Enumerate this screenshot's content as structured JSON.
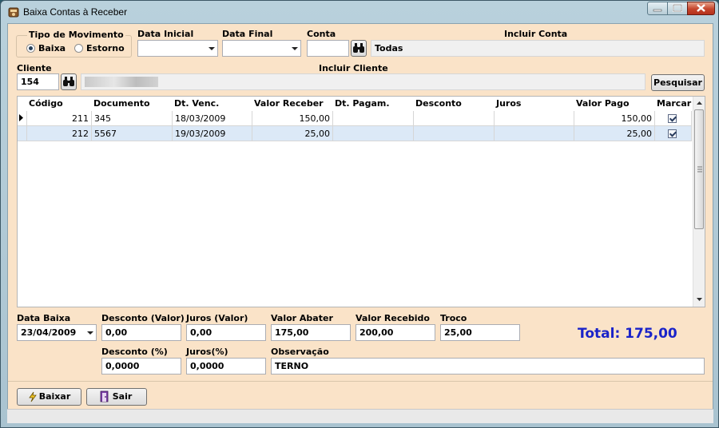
{
  "window": {
    "title": "Baixa Contas à Receber"
  },
  "filters": {
    "tipo_movimento_label": "Tipo de Movimento",
    "radio_baixa": "Baixa",
    "radio_estorno": "Estorno",
    "selected": "Baixa",
    "data_inicial_label": "Data Inicial",
    "data_inicial": "",
    "data_final_label": "Data Final",
    "data_final": "",
    "conta_label": "Conta",
    "conta": "",
    "incluir_conta_label": "Incluir Conta",
    "incluir_conta": "Todas",
    "cliente_label": "Cliente",
    "cliente": "154",
    "incluir_cliente_label": "Incluir Cliente",
    "incluir_cliente": "",
    "pesquisar": "Pesquisar"
  },
  "grid": {
    "headers": [
      "Código",
      "Documento",
      "Dt. Venc.",
      "Valor Receber",
      "Dt. Pagam.",
      "Desconto",
      "Juros",
      "Valor Pago",
      "Marcar"
    ],
    "rows": [
      {
        "codigo": "211",
        "documento": "345",
        "dt_venc": "18/03/2009",
        "valor_receber": "150,00",
        "dt_pagam": "",
        "desconto": "",
        "juros": "",
        "valor_pago": "150,00",
        "marcar": true
      },
      {
        "codigo": "212",
        "documento": "5567",
        "dt_venc": "19/03/2009",
        "valor_receber": "25,00",
        "dt_pagam": "",
        "desconto": "",
        "juros": "",
        "valor_pago": "25,00",
        "marcar": true
      }
    ]
  },
  "footer": {
    "data_baixa_label": "Data Baixa",
    "data_baixa": "23/04/2009",
    "desconto_valor_label": "Desconto (Valor)",
    "desconto_valor": "0,00",
    "juros_valor_label": "Juros (Valor)",
    "juros_valor": "0,00",
    "valor_abater_label": "Valor Abater",
    "valor_abater": "175,00",
    "valor_recebido_label": "Valor Recebido",
    "valor_recebido": "200,00",
    "troco_label": "Troco",
    "troco": "25,00",
    "desconto_pct_label": "Desconto (%)",
    "desconto_pct": "0,0000",
    "juros_pct_label": "Juros(%)",
    "juros_pct": "0,0000",
    "observacao_label": "Observação",
    "observacao": "TERNO",
    "total": "Total: 175,00"
  },
  "actions": {
    "baixar": "Baixar",
    "sair": "Sair"
  },
  "icons": [
    "app-icon",
    "binoculars-icon",
    "lightning-icon",
    "exit-door-icon"
  ],
  "colors": {
    "form_bg": "#fae3c8",
    "total_text": "#1a23c9",
    "row_highlight": "#dce9f7"
  }
}
